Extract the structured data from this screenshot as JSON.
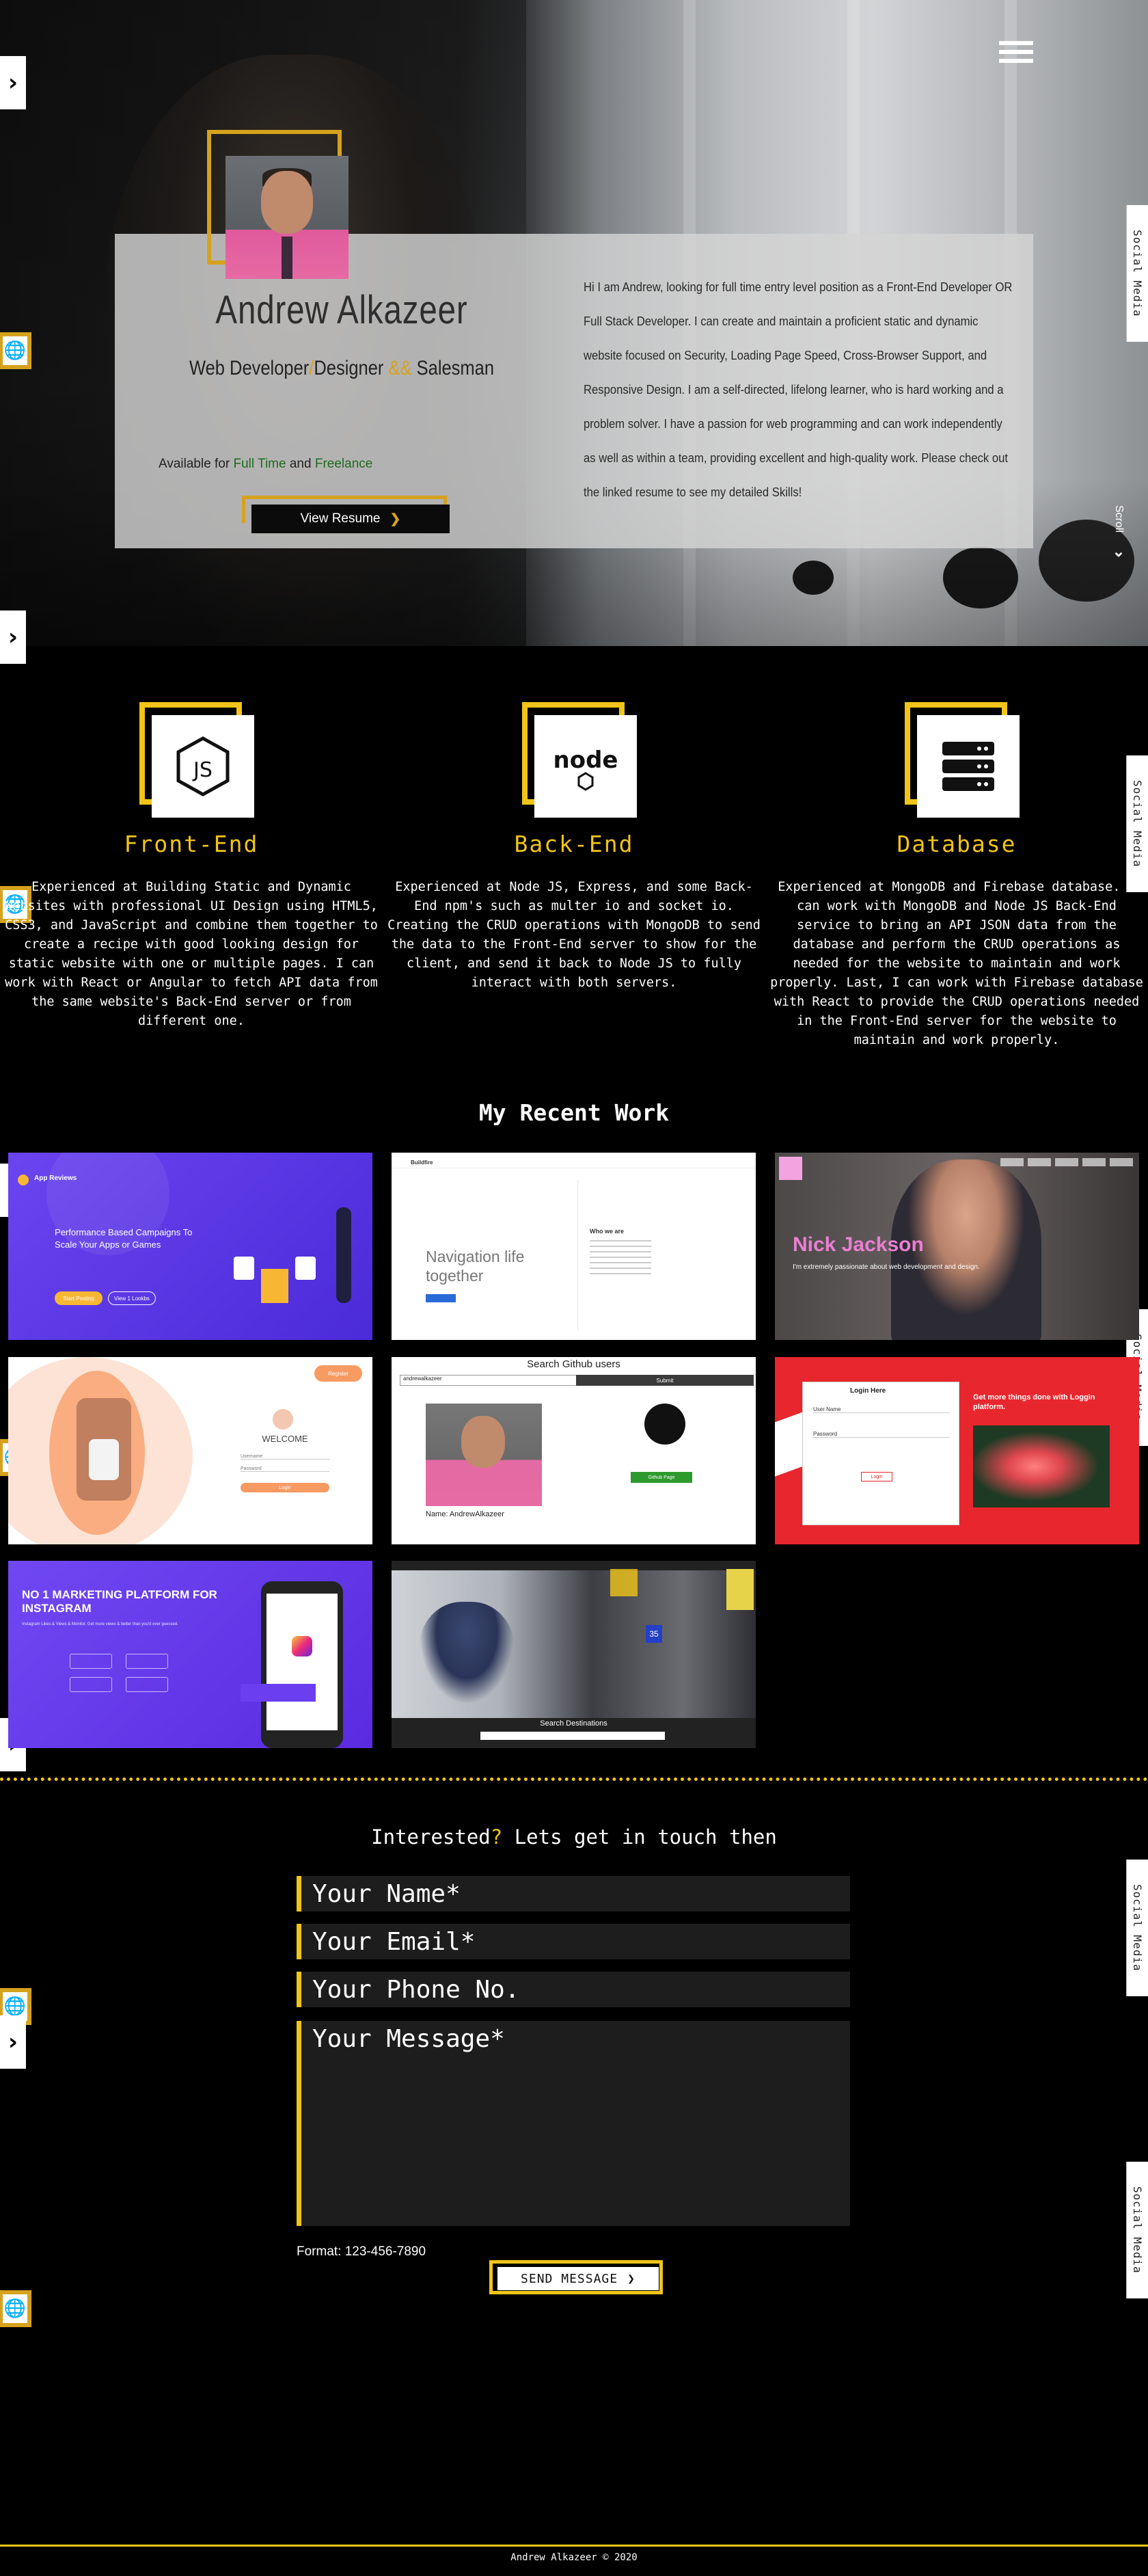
{
  "hero": {
    "name": "Andrew Alkazeer",
    "role_part1": "Web Developer",
    "role_slash": "/",
    "role_part2": "Designer",
    "role_and": "&&",
    "role_part3": "Salesman",
    "avail_prefix": "Available for ",
    "avail_fulltime": "Full Time",
    "avail_and": " and ",
    "avail_freelance": "Freelance",
    "resume_label": "View Resume",
    "bio": "Hi I am Andrew, looking for full time entry level position as a Front-End Developer OR Full Stack Developer. I can create and maintain a proficient static and dynamic website focused on Security, Loading Page Speed, Cross-Browser Support, and Responsive Design. I am a self-directed, lifelong learner, who is hard working and a problem solver. I have a passion for web programming and can work independently as well as within a team, providing excellent and high-quality work. Please check out the linked resume to see my detailed Skills!",
    "scroll_label": "Scroll"
  },
  "side": {
    "social_label": "Social Media"
  },
  "skills": [
    {
      "title": "Front-End",
      "desc": "Experienced at Building Static and Dynamic Websites with professional UI Design using HTML5, CSS3, and JavaScript and combine them together to create a recipe with good looking design for static website with one or multiple pages. I can work with React or Angular to fetch API data from the same website's Back-End server or from different one."
    },
    {
      "title": "Back-End",
      "desc": "Experienced at Node JS, Express, and some Back-End npm's such as multer io and socket io. Creating the CRUD operations with MongoDB to send the data to the Front-End server to show for the client, and send it back to Node JS to fully interact with both servers."
    },
    {
      "title": "Database",
      "desc": "Experienced at MongoDB and Firebase database. I can work with MongoDB and Node JS Back-End service to bring an API JSON data from the database and perform the CRUD operations as needed for the website to maintain and work properly. Last, I can work with Firebase database with React to provide the CRUD operations needed in the Front-End server for the website to maintain and work properly."
    }
  ],
  "work": {
    "title": "My Recent Work",
    "t1": {
      "brand": "App Reviews",
      "heading": "Performance Based Campaigns To Scale Your Apps or Games",
      "btn1": "Start Posting",
      "btn2": "View 1 Lookbs"
    },
    "t2": {
      "brand": "Buildfire",
      "heading": "Navigation life together",
      "sub": "Who we are"
    },
    "t3": {
      "name": "Nick Jackson",
      "tagline": "I'm extremely passionate about web development and design."
    },
    "t4": {
      "welcome": "WELCOME",
      "user": "Username",
      "pass": "Password",
      "btn": "Login",
      "corner": "Register"
    },
    "t5": {
      "title": "Search Github users",
      "input": "andrewalkazeer",
      "btn": "Submit",
      "name": "Name: AndrewAlkazeer",
      "green": "Github Page"
    },
    "t6": {
      "login": "Login Here",
      "user": "User Name",
      "pass": "Password",
      "btn": "Login",
      "heading": "Get more things done with Loggin platform."
    },
    "t7": {
      "heading": "NO 1 MARKETING PLATFORM FOR INSTAGRAM",
      "sub": "Instagram Likes & Views & Monitor. Get more views & better than you'd ever guessed."
    },
    "t8": {
      "banner": "Search Destinations",
      "gate": "35"
    }
  },
  "contact": {
    "title_pre": "Interested",
    "title_q": "?",
    "title_post": " Lets get in touch then",
    "name_ph": "Your Name*",
    "email_ph": "Your Email*",
    "phone_ph": "Your Phone No.",
    "message_ph": "Your Message*",
    "format_note": "Format: 123-456-7890",
    "send_label": "SEND MESSAGE"
  },
  "footer": {
    "text": "Andrew Alkazeer © 2020"
  },
  "colors": {
    "accent": "#f0c419",
    "gold": "#d6a21d",
    "background": "#000000"
  }
}
